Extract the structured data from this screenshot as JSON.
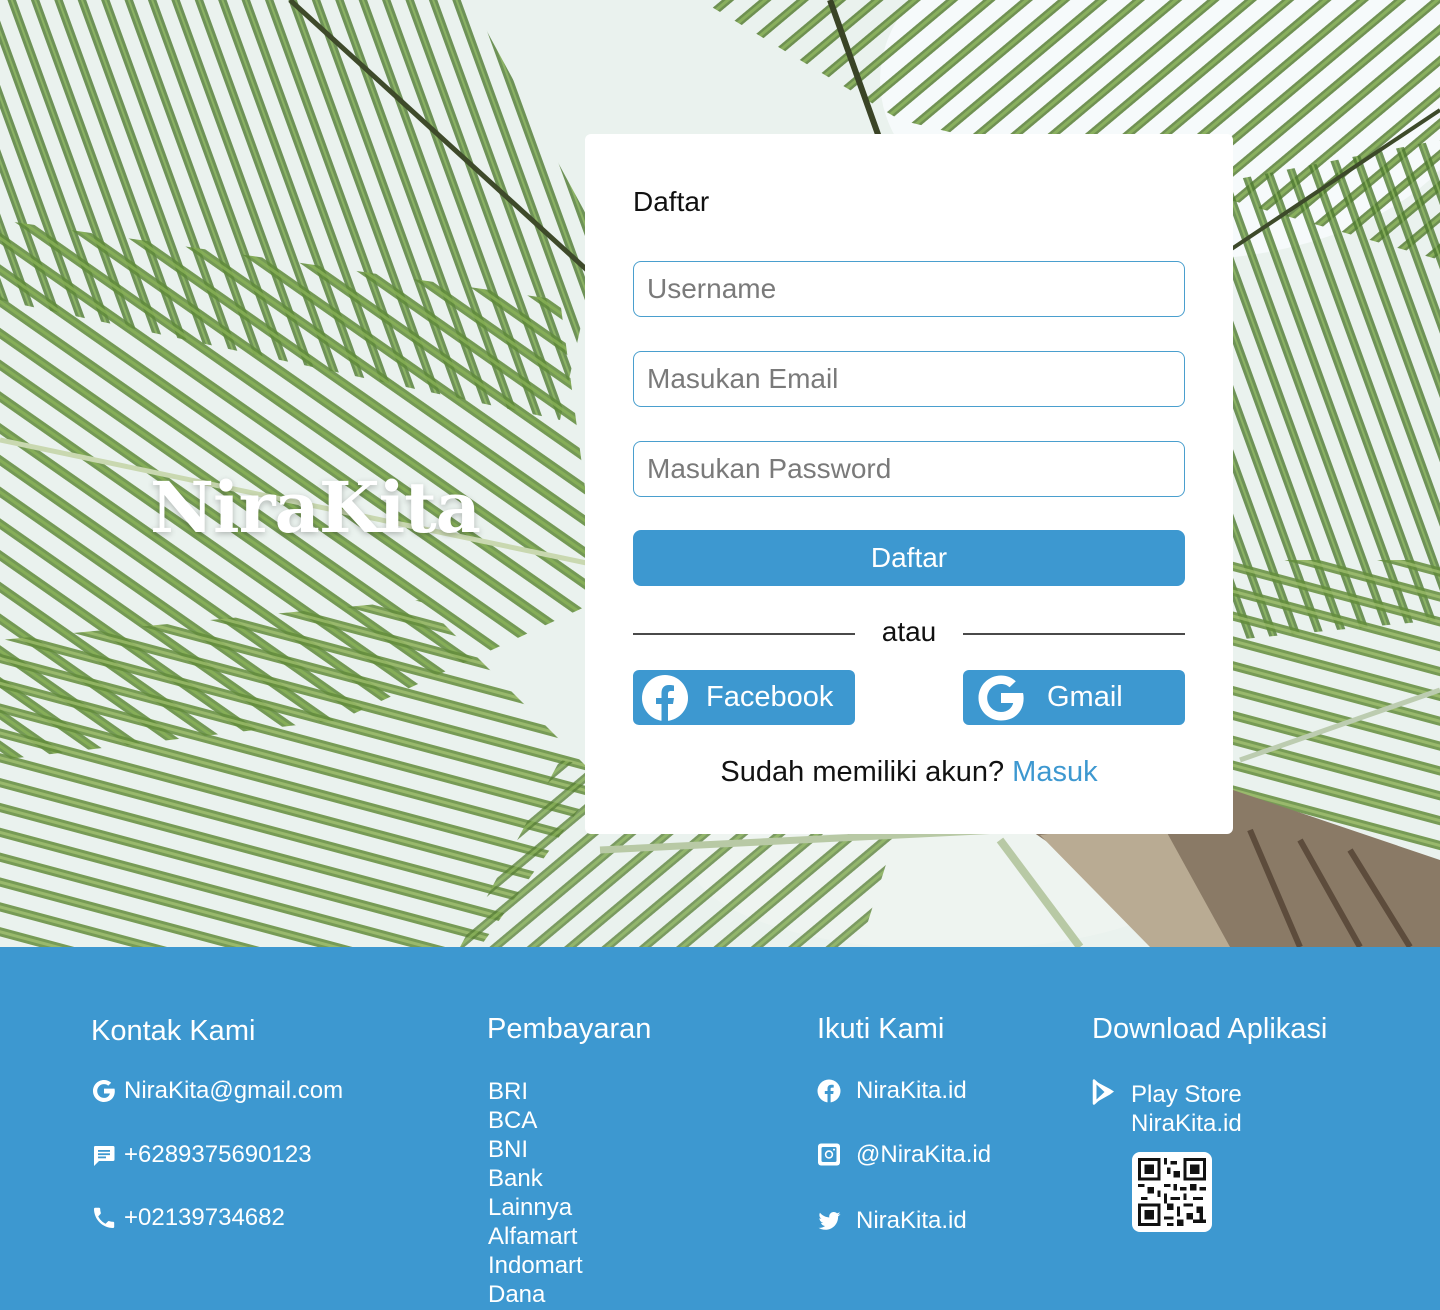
{
  "brand": {
    "name": "NiraKita"
  },
  "signup": {
    "title": "Daftar",
    "username_placeholder": "Username",
    "email_placeholder": "Masukan Email",
    "password_placeholder": "Masukan Password",
    "submit_label": "Daftar",
    "divider_text": "atau",
    "facebook_label": "Facebook",
    "gmail_label": "Gmail",
    "have_account_text": "Sudah memiliki akun?",
    "login_link": "Masuk"
  },
  "footer": {
    "contact": {
      "title": "Kontak Kami",
      "email": "NiraKita@gmail.com",
      "sms": "+6289375690123",
      "phone": "+02139734682"
    },
    "payment": {
      "title": "Pembayaran",
      "items": [
        "BRI",
        "BCA",
        "BNI",
        "Bank Lainnya",
        "Alfamart",
        "Indomart",
        "Dana"
      ]
    },
    "follow": {
      "title": "Ikuti Kami",
      "facebook": "NiraKita.id",
      "instagram": "@NiraKita.id",
      "twitter": "NiraKita.id"
    },
    "download": {
      "title": "Download Aplikasi",
      "store": "Play Store",
      "store_handle": "NiraKita.id"
    }
  },
  "colors": {
    "accent": "#3d98d0",
    "card_bg": "#ffffff",
    "palm_green": "#5f8a3a"
  },
  "icons": {
    "facebook": "facebook-icon",
    "google": "google-icon",
    "sms": "message-icon",
    "phone": "phone-icon",
    "instagram": "instagram-icon",
    "twitter": "twitter-icon",
    "play_store": "play-store-icon",
    "qr": "qr-code-icon"
  }
}
